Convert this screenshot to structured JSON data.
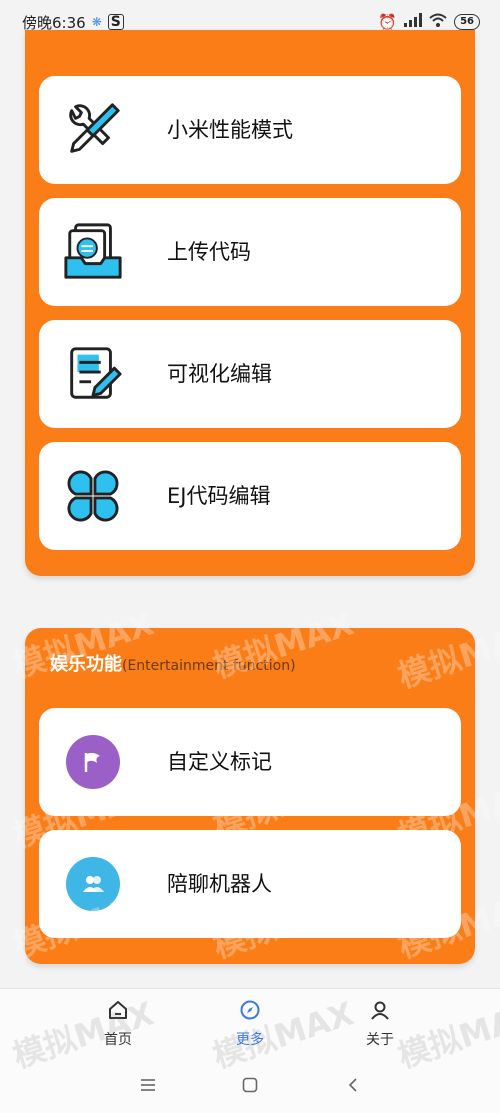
{
  "status_bar": {
    "time": "傍晚6:36",
    "battery": "56"
  },
  "main_section": {
    "items": [
      {
        "label": "小米性能模式",
        "icon": "tools-icon"
      },
      {
        "label": "上传代码",
        "icon": "upload-document-icon"
      },
      {
        "label": "可视化编辑",
        "icon": "edit-document-icon"
      },
      {
        "label": "EJ代码编辑",
        "icon": "grid-clover-icon"
      }
    ]
  },
  "entertainment_section": {
    "title": "娱乐功能",
    "subtitle": "(Entertainment function)",
    "items": [
      {
        "label": "自定义标记",
        "icon": "flag-icon",
        "color": "#9b5fc8"
      },
      {
        "label": "陪聊机器人",
        "icon": "users-icon",
        "color": "#3fb6e6"
      }
    ]
  },
  "tab_bar": {
    "tabs": [
      {
        "label": "首页",
        "icon": "home-icon"
      },
      {
        "label": "更多",
        "icon": "compass-icon",
        "active": true
      },
      {
        "label": "关于",
        "icon": "person-icon"
      }
    ]
  },
  "watermark": "模拟MAX",
  "colors": {
    "accent": "#fb7d17",
    "active_tab": "#3b78e7",
    "icon_blue": "#2ec0ef"
  }
}
